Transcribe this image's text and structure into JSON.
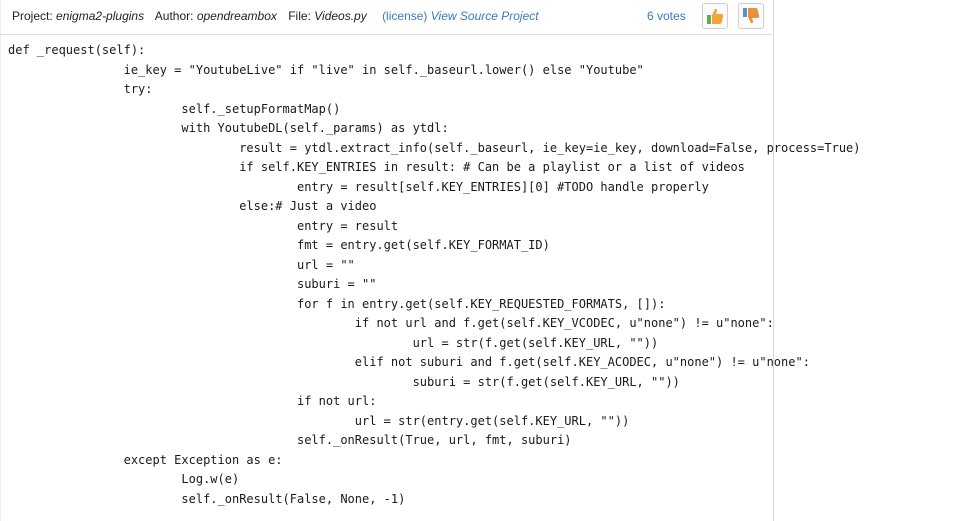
{
  "header": {
    "project_key": "Project:",
    "project": "enigma2-plugins",
    "author_key": "Author:",
    "author": "opendreambox",
    "file_key": "File:",
    "file": "Videos.py",
    "license": "(license)",
    "view_source": "View Source Project",
    "votes": "6 votes",
    "icons": {
      "up": "thumbs-up-icon",
      "down": "thumbs-down-icon"
    },
    "colors": {
      "link": "#3a79c4",
      "up": "#f0a43a",
      "down": "#e8903a",
      "green": "#6aa84f"
    }
  },
  "code": {
    "lines": [
      "def _request(self):",
      "\t\tie_key = \"YoutubeLive\" if \"live\" in self._baseurl.lower() else \"Youtube\"",
      "\t\ttry:",
      "\t\t\tself._setupFormatMap()",
      "\t\t\twith YoutubeDL(self._params) as ytdl:",
      "\t\t\t\tresult = ytdl.extract_info(self._baseurl, ie_key=ie_key, download=False, process=True)",
      "\t\t\t\tif self.KEY_ENTRIES in result: # Can be a playlist or a list of videos",
      "\t\t\t\t\tentry = result[self.KEY_ENTRIES][0] #TODO handle properly",
      "\t\t\t\telse:# Just a video",
      "\t\t\t\t\tentry = result",
      "\t\t\t\t\tfmt = entry.get(self.KEY_FORMAT_ID)",
      "\t\t\t\t\turl = \"\"",
      "\t\t\t\t\tsuburi = \"\"",
      "\t\t\t\t\tfor f in entry.get(self.KEY_REQUESTED_FORMATS, []):",
      "\t\t\t\t\t\tif not url and f.get(self.KEY_VCODEC, u\"none\") != u\"none\":",
      "\t\t\t\t\t\t\turl = str(f.get(self.KEY_URL, \"\"))",
      "\t\t\t\t\t\telif not suburi and f.get(self.KEY_ACODEC, u\"none\") != u\"none\":",
      "\t\t\t\t\t\t\tsuburi = str(f.get(self.KEY_URL, \"\"))",
      "\t\t\t\t\tif not url:",
      "\t\t\t\t\t\turl = str(entry.get(self.KEY_URL, \"\"))",
      "\t\t\t\t\tself._onResult(True, url, fmt, suburi)",
      "\t\texcept Exception as e:",
      "\t\t\tLog.w(e)",
      "\t\t\tself._onResult(False, None, -1)"
    ]
  }
}
